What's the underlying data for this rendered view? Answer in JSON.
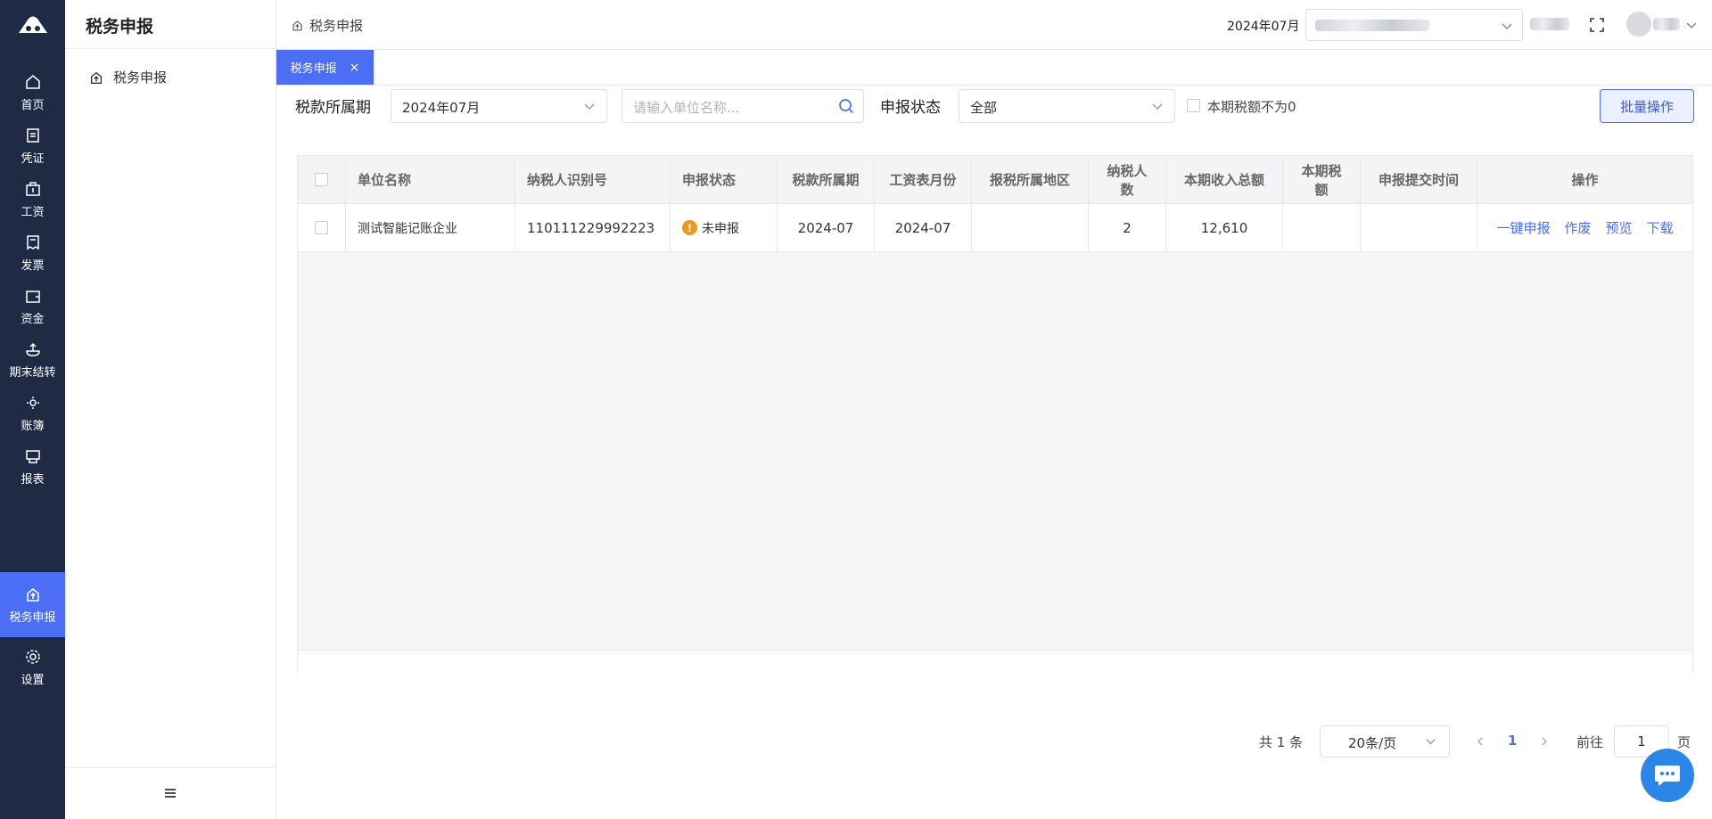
{
  "colors": {
    "nav_bg": "#1f2a44",
    "accent": "#4c6ef5",
    "warning": "#f0961b",
    "chat_fab": "#2b86e8"
  },
  "nav": {
    "items": [
      {
        "label": "首页",
        "icon": "home-icon"
      },
      {
        "label": "凭证",
        "icon": "voucher-icon"
      },
      {
        "label": "工资",
        "icon": "salary-icon"
      },
      {
        "label": "发票",
        "icon": "invoice-icon"
      },
      {
        "label": "资金",
        "icon": "wallet-icon"
      },
      {
        "label": "期末结转",
        "icon": "period-end-icon"
      },
      {
        "label": "账簿",
        "icon": "ledger-icon"
      },
      {
        "label": "报表",
        "icon": "report-icon"
      },
      {
        "label": "税务申报",
        "icon": "tax-declare-icon",
        "active": true
      },
      {
        "label": "设置",
        "icon": "gear-icon"
      }
    ]
  },
  "subnav": {
    "title": "税务申报",
    "items": [
      {
        "label": "税务申报",
        "icon": "tax-declare-icon"
      }
    ]
  },
  "header": {
    "breadcrumb": "税务申报",
    "period": "2024年07月"
  },
  "tabs": [
    {
      "label": "税务申报",
      "close": "×"
    }
  ],
  "filters": {
    "period_label": "税款所属期",
    "period_value": "2024年07月",
    "search_placeholder": "请输入单位名称...",
    "status_label": "申报状态",
    "status_value": "全部",
    "nonzero_label": "本期税额不为0",
    "batch_button": "批量操作"
  },
  "table": {
    "headers": {
      "name": "单位名称",
      "tax_id": "纳税人识别号",
      "status": "申报状态",
      "period": "税款所属期",
      "payroll_month": "工资表月份",
      "region": "报税所属地区",
      "taxpayers": "纳税人数",
      "income_total": "本期收入总额",
      "tax_amount": "本期税额",
      "submit_time": "申报提交时间",
      "ops": "操作"
    },
    "rows": [
      {
        "name": "测试智能记账企业",
        "tax_id": "110111229992223",
        "status": "未申报",
        "period": "2024-07",
        "payroll_month": "2024-07",
        "region": "",
        "taxpayers": "2",
        "income_total": "12,610",
        "tax_amount": "",
        "submit_time": "",
        "ops": {
          "declare": "一键申报",
          "void": "作废",
          "preview": "预览",
          "download": "下载"
        }
      }
    ]
  },
  "pagination": {
    "total": "共 1 条",
    "page_size": "20条/页",
    "current": "1",
    "goto_label": "前往",
    "goto_value": "1",
    "page_unit": "页"
  }
}
